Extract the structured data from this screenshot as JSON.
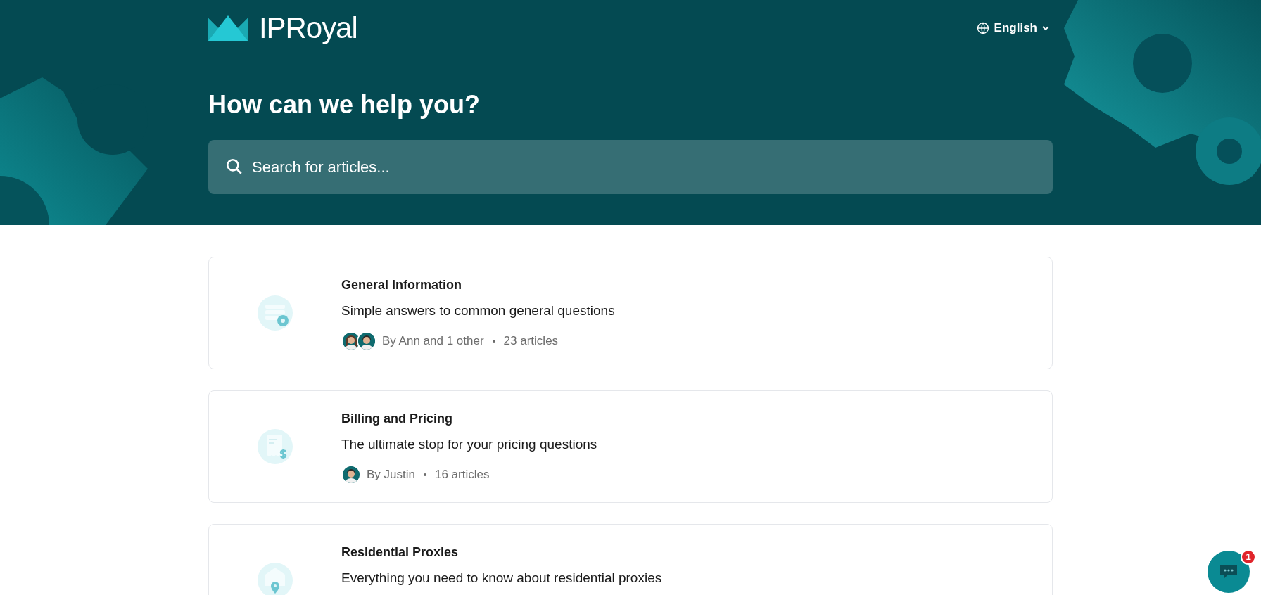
{
  "header": {
    "logo_text": "IPRoyal",
    "language": "English",
    "heading": "How can we help you?",
    "search": {
      "placeholder": "Search for articles..."
    }
  },
  "collections": [
    {
      "kind": "settings",
      "title": "General Information",
      "description": "Simple answers to common general questions",
      "avatars": [
        {
          "kind": "woman"
        },
        {
          "kind": "man"
        }
      ],
      "authors": "By Ann and 1 other",
      "count": "23 articles"
    },
    {
      "kind": "billing",
      "title": "Billing and Pricing",
      "description": "The ultimate stop for your pricing questions",
      "avatars": [
        {
          "kind": "man"
        }
      ],
      "authors": "By Justin",
      "count": "16 articles"
    },
    {
      "kind": "location",
      "title": "Residential Proxies",
      "description": "Everything you need to know about residential proxies"
    }
  ],
  "chat": {
    "badge": "1"
  }
}
